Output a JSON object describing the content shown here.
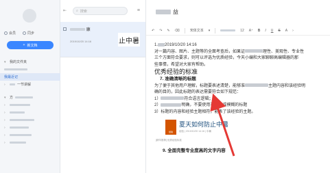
{
  "sidebar": {
    "meeting_label": "会员",
    "sync_label": "同步",
    "new_button_label": "新文档",
    "tree": {
      "my_folder": "我的文件夹",
      "active_item": "我最近记",
      "sub_item_1": "一节讲解",
      "item_prefix": "方"
    }
  },
  "notelist": {
    "search_placeholder": "搜索",
    "card": {
      "title": "康",
      "date": "2019/10/20 14:16",
      "thumb_text": "止中暑"
    }
  },
  "editor": {
    "title": "益",
    "toolbar": {
      "font": "宋体文本",
      "size": "12"
    },
    "date_line": "2019/10/20 14:16",
    "para1": "对一篇内容、图片、主题等的全面考查后，如果证",
    "para1_tail": "理性、美观性、专业性",
    "para2": "三个方面符合要求，则可以评选为优质经验，今天小编和大家聊聊高编辑器的那",
    "para3": "些事情，希望对大家有帮助。",
    "heading": "优秀经验的标准",
    "h3_1": "7. 准确清晰的标题",
    "p4": "为了便于其他用户理解，标题要表述清楚，能够准",
    "p4_tail": "主题内容和该经验明",
    "p5": "确的目的，因此标题的表达需要符合如下规范：",
    "li1_prefix": "1）",
    "li1_tail": "符合语言逻辑；",
    "li2_prefix": "2）",
    "li2_tail": "明确，不要使用不定义或模糊的标题",
    "li3": "3）标题的内容和经验主题相符，能表了该经验的主题。",
    "article_title": "夏天如何防止中暑",
    "article_meta": "经验 | 2019/10/20 14:16 | 中暑",
    "article_logo": "经验",
    "tagline": "[精华推荐] 优秀经验标准",
    "h3_2": "9. 全面完整专业度高的文字内容"
  },
  "colors": {
    "accent": "#3a86ff",
    "arrow": "#e53935"
  }
}
